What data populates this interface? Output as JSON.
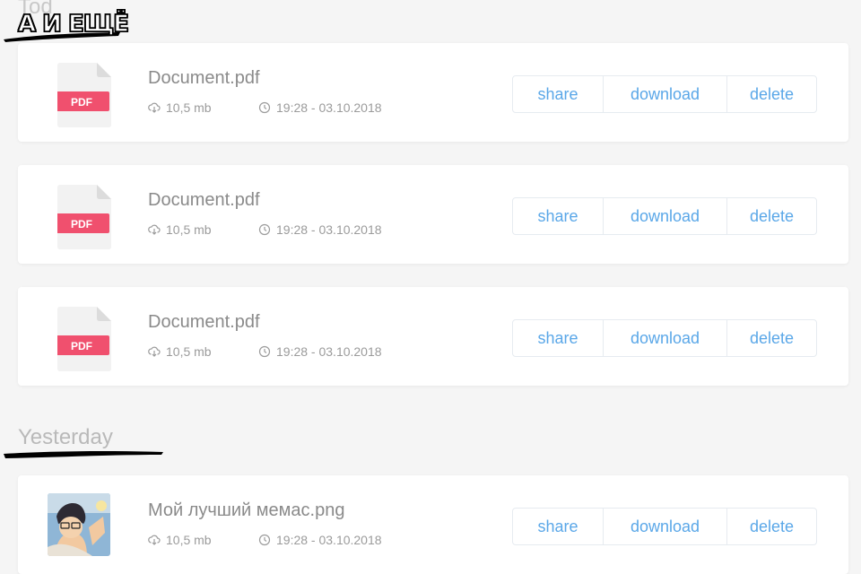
{
  "overlay_caption": "А И ЕЩЁ",
  "sections": [
    {
      "heading": "Tod",
      "files": [
        {
          "name": "Document.pdf",
          "type_badge": "PDF",
          "icon": "pdf-file-icon",
          "size": "10,5 mb",
          "datetime": "19:28 - 03.10.2018"
        },
        {
          "name": "Document.pdf",
          "type_badge": "PDF",
          "icon": "pdf-file-icon",
          "size": "10,5 mb",
          "datetime": "19:28 - 03.10.2018"
        },
        {
          "name": "Document.pdf",
          "type_badge": "PDF",
          "icon": "pdf-file-icon",
          "size": "10,5 mb",
          "datetime": "19:28 - 03.10.2018"
        }
      ]
    },
    {
      "heading": "Yesterday",
      "files": [
        {
          "name": "Мой лучший мемас.png",
          "icon": "image-thumbnail",
          "size": "10,5 mb",
          "datetime": "19:28 - 03.10.2018"
        }
      ]
    }
  ],
  "actions": {
    "share": "share",
    "download": "download",
    "delete": "delete"
  },
  "colors": {
    "accent": "#5aa7e8",
    "pdf_badge": "#f0506e",
    "background": "#f5f5f5",
    "card": "#ffffff"
  }
}
